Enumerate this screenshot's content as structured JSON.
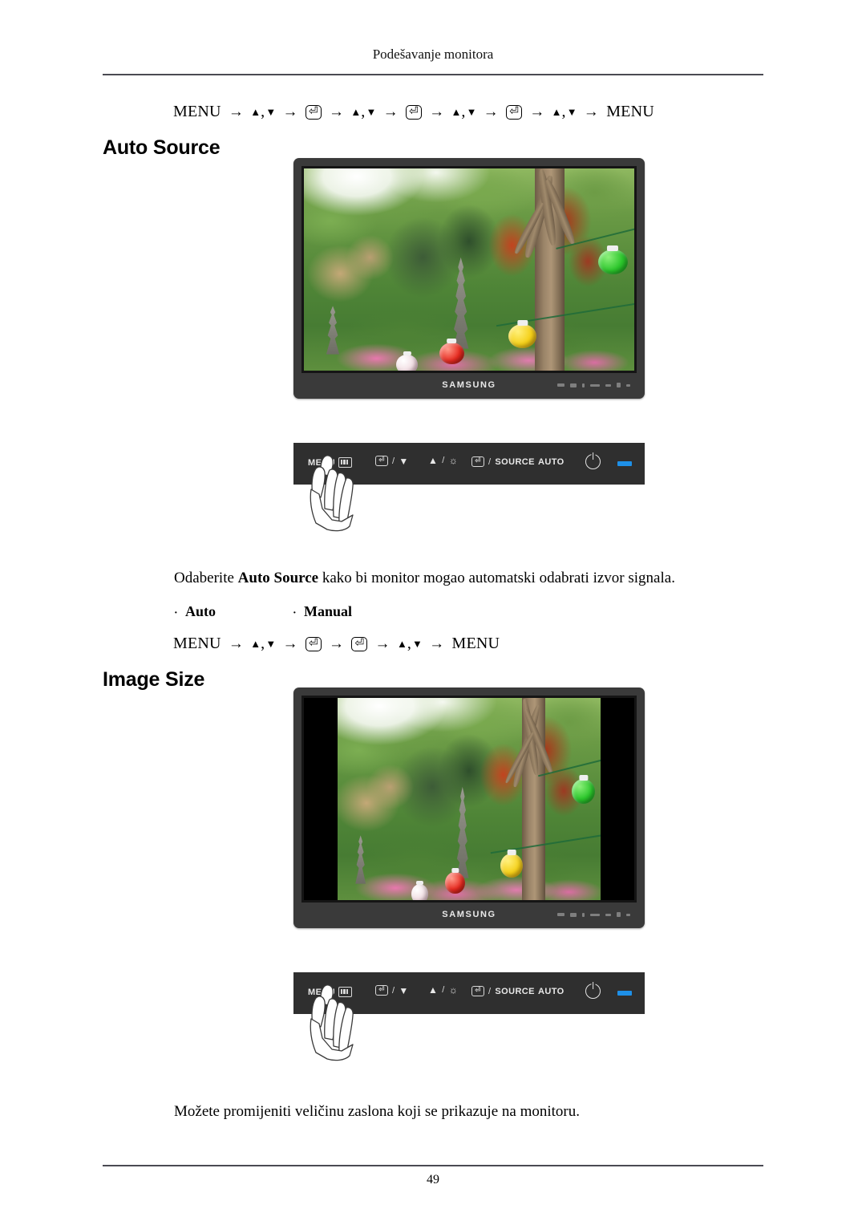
{
  "page": {
    "header_title": "Podešavanje monitora",
    "page_number": "49"
  },
  "nav_paths": {
    "auto_source": {
      "start": "MENU",
      "end": "MENU",
      "arrow": "→",
      "comma": ",",
      "up": "▲",
      "down": "▼",
      "enter": "⏎"
    },
    "image_size": {
      "start": "MENU",
      "end": "MENU",
      "arrow": "→",
      "comma": ",",
      "up": "▲",
      "down": "▼",
      "enter": "⏎"
    }
  },
  "sections": [
    {
      "id": "auto-source",
      "heading": "Auto Source",
      "description_prefix": "Odaberite ",
      "description_bold": "Auto Source",
      "description_suffix": " kako bi monitor mogao automatski odabrati izvor signala.",
      "options": [
        "Auto",
        "Manual"
      ]
    },
    {
      "id": "image-size",
      "heading": "Image Size",
      "description": "Možete promijeniti veličinu zaslona koji se prikazuje na monitoru."
    }
  ],
  "monitor": {
    "brand": "SAMSUNG",
    "bezel_color": "#3a3a3a",
    "screen_image_alt": "garden-photo-pagodas-lanterns"
  },
  "osd_panel": {
    "background_color": "#2f2f2f",
    "led_color": "#1e90e8",
    "buttons": [
      {
        "name": "menu",
        "label": "MENU",
        "icon": "menu-button-icon"
      },
      {
        "name": "down",
        "label": "",
        "icon_left": "enter-key",
        "separator": "/",
        "icon_right": "▼"
      },
      {
        "name": "up",
        "label": "",
        "icon_left": "▲",
        "separator": "/",
        "icon_right": "☼"
      },
      {
        "name": "source",
        "label": "SOURCE",
        "icon_left": "enter-key",
        "separator": "/"
      },
      {
        "name": "auto",
        "label": "AUTO"
      },
      {
        "name": "power",
        "label": "",
        "icon": "power-icon"
      },
      {
        "name": "led",
        "label": "",
        "icon": "led-indicator"
      }
    ]
  }
}
